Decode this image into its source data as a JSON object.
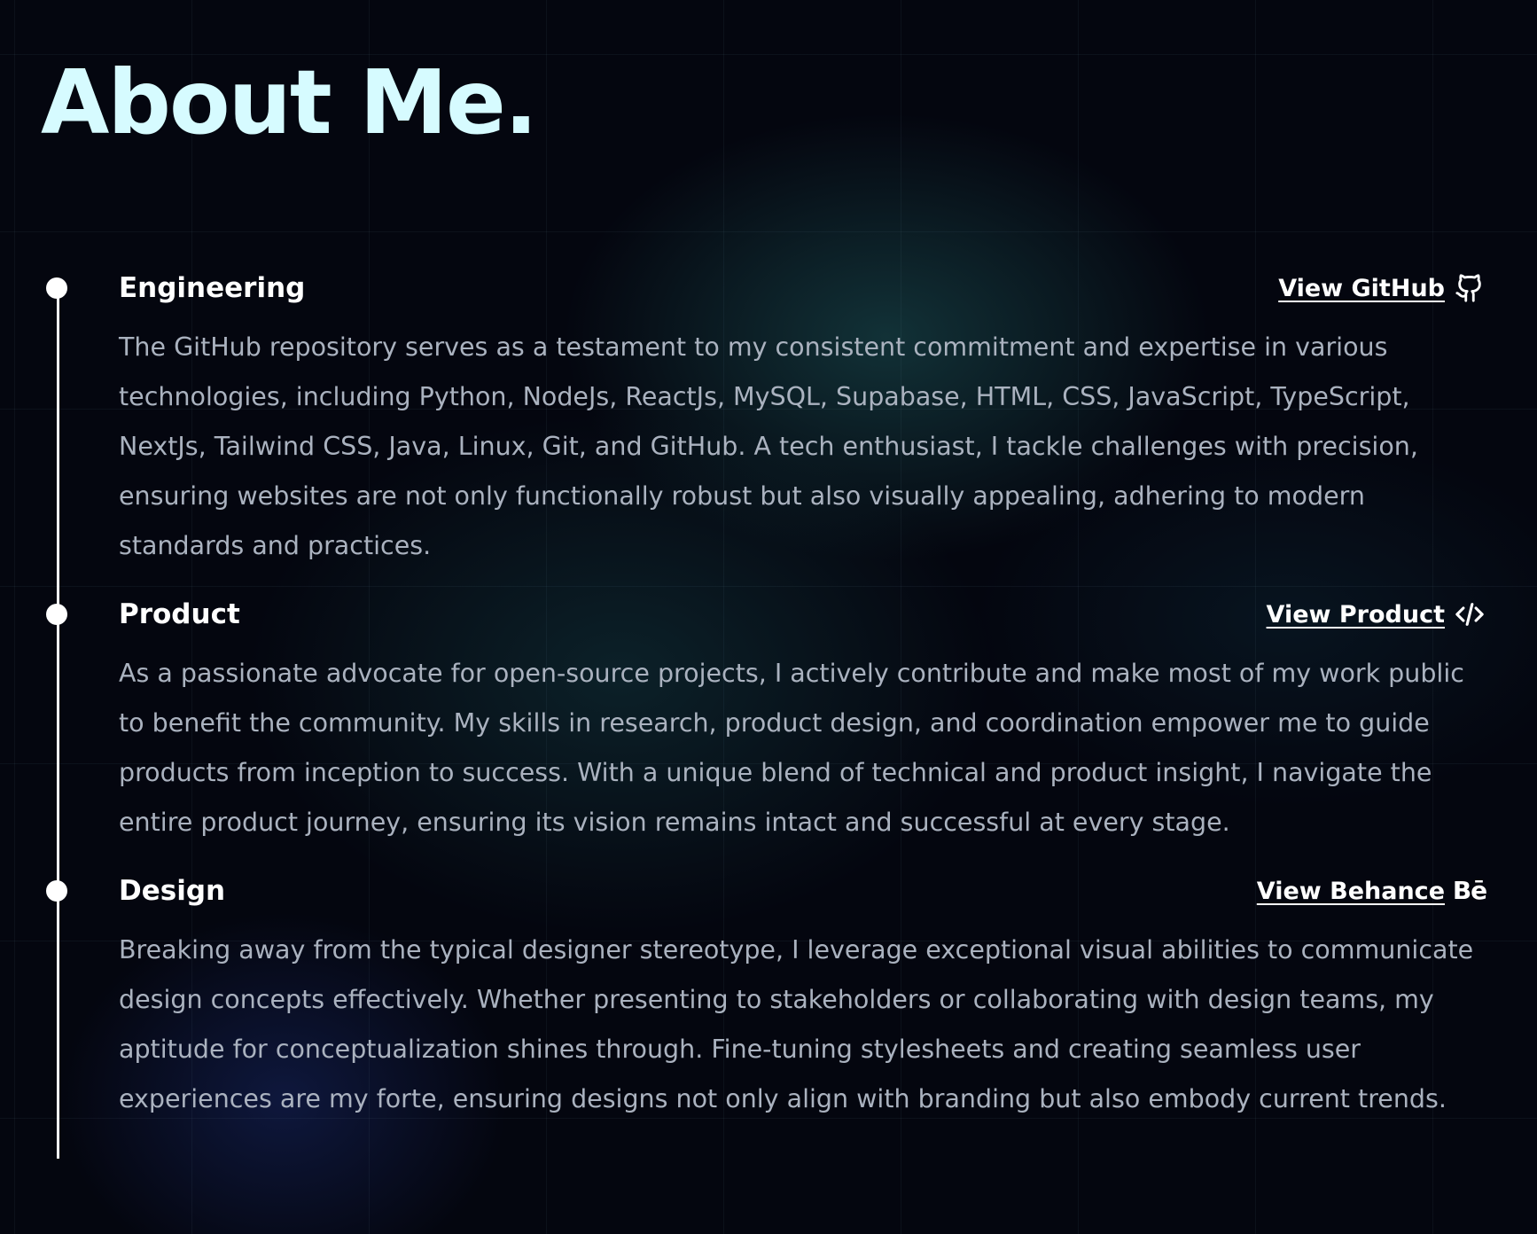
{
  "page": {
    "title": "About Me."
  },
  "sections": [
    {
      "title": "Engineering",
      "link_label": "View GitHub",
      "icon": "github-icon",
      "body": "The GitHub repository serves as a testament to my consistent commitment and expertise in various technologies, including Python, NodeJs, ReactJs, MySQL, Supabase, HTML, CSS, JavaScript, TypeScript, NextJs, Tailwind CSS, Java, Linux, Git, and GitHub. A tech enthusiast, I tackle challenges with precision, ensuring websites are not only functionally robust but also visually appealing, adhering to modern standards and practices."
    },
    {
      "title": "Product",
      "link_label": "View Product",
      "icon": "code-icon",
      "body": "As a passionate advocate for open-source projects, I actively contribute and make most of my work public to benefit the community. My skills in research, product design, and coordination empower me to guide products from inception to success. With a unique blend of technical and product insight, I navigate the entire product journey, ensuring its vision remains intact and successful at every stage."
    },
    {
      "title": "Design",
      "link_label": "View Behance",
      "icon": "behance-icon",
      "icon_text": "Bē",
      "body": "Breaking away from the typical designer stereotype, I leverage exceptional visual abilities to communicate design concepts effectively. Whether presenting to stakeholders or collaborating with design teams, my aptitude for conceptualization shines through. Fine-tuning stylesheets and creating seamless user experiences are my forte, ensuring designs not only align with branding but also embody current trends."
    }
  ],
  "colors": {
    "background": "#04060f",
    "title": "#d6fbff",
    "heading": "#ffffff",
    "body_text": "#aab2bf",
    "timeline": "#ffffff"
  }
}
